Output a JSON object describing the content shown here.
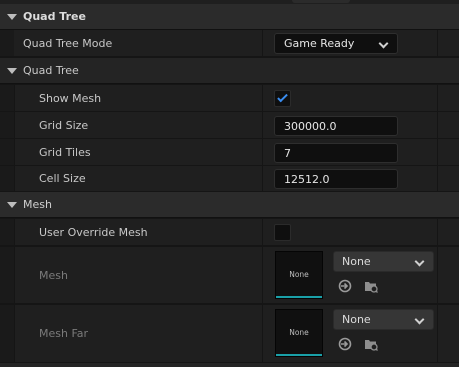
{
  "categories": {
    "quad_tree": "Quad Tree",
    "mesh": "Mesh"
  },
  "quad_tree_mode": {
    "label": "Quad Tree Mode",
    "value": "Game Ready"
  },
  "quad_tree_group": {
    "title": "Quad Tree",
    "show_mesh": {
      "label": "Show Mesh",
      "checked": true
    },
    "grid_size": {
      "label": "Grid Size",
      "value": "300000.0"
    },
    "grid_tiles": {
      "label": "Grid Tiles",
      "value": "7"
    },
    "cell_size": {
      "label": "Cell Size",
      "value": "12512.0"
    }
  },
  "mesh_group": {
    "user_override_mesh": {
      "label": "User Override Mesh",
      "checked": false
    },
    "mesh": {
      "label": "Mesh",
      "thumbnail": "None",
      "selected": "None"
    },
    "mesh_far": {
      "label": "Mesh Far",
      "thumbnail": "None",
      "selected": "None"
    }
  },
  "icons": [
    "collapse-arrow-icon",
    "chevron-down-icon",
    "checkmark-icon",
    "use-selected-icon",
    "browse-asset-icon"
  ],
  "colors": {
    "accent_blue": "#3a8df0",
    "thumbnail_bar": "#1aa0a8"
  }
}
